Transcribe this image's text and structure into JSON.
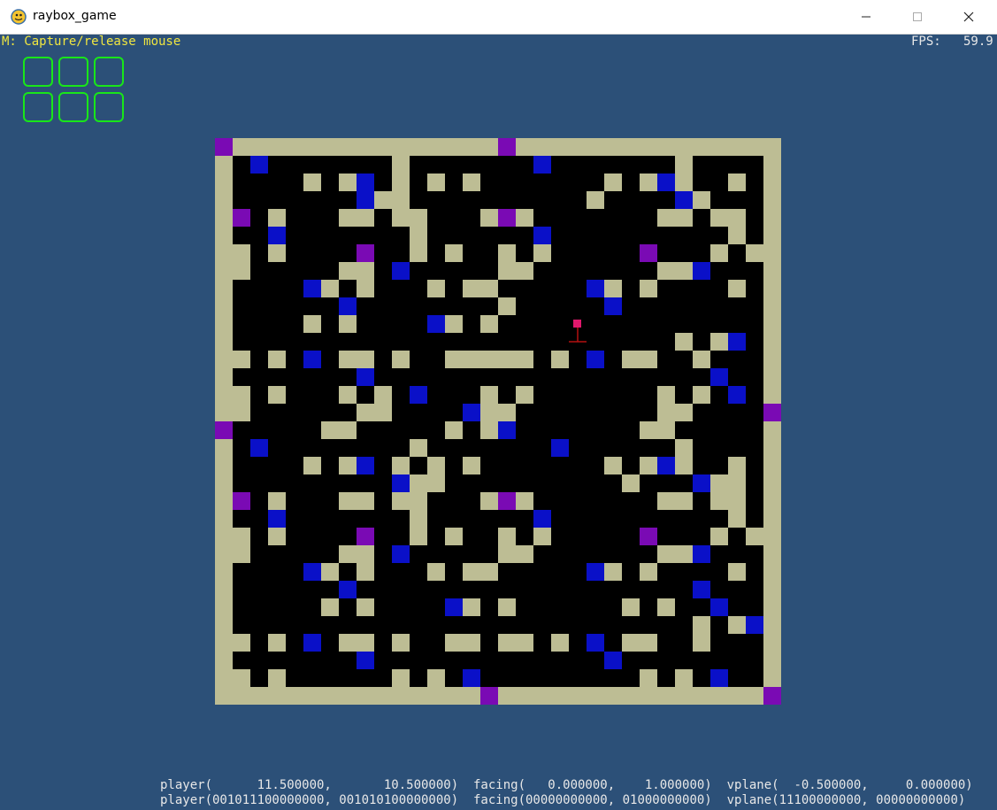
{
  "window": {
    "title": "raybox_game",
    "minimize_label": "Minimize",
    "maximize_label": "Maximize",
    "close_label": "Close"
  },
  "hud": {
    "help_text": "M: Capture/release mouse",
    "fps_text": "FPS:   59.9"
  },
  "inventory": {
    "slots": 6
  },
  "debug": {
    "line1": "player(      11.500000,       10.500000)  facing(   0.000000,    1.000000)  vplane(  -0.500000,     0.000000)",
    "line2": "player(001011100000000, 001010100000000)  facing(00000000000, 01000000000)  vplane(11100000000, 00000000000)"
  },
  "colors": {
    "background": "#2c5078",
    "floor": "#000000",
    "wall": "#bdbd94",
    "blue": "#0a10c8",
    "purple": "#7a0ab4",
    "player": "#e0186c",
    "facing": "#b41010",
    "slot_border": "#19e619"
  },
  "map": {
    "cols": 32,
    "rows": 32,
    "legend": {
      ".": "floor",
      "#": "wall",
      "b": "blue",
      "p": "purple"
    },
    "cells": [
      "p###############p###############",
      "#.b.......#.......b.......#....#",
      "#....#.#b.#.#.#.......#.#b#..#.#",
      "#.......b##..........#....b#...#",
      "#p.#...##.##...#p#.......##.##.#",
      "#..b.......#......b..........#.#",
      "##.#....p..#.#..#.#.....p...#.##",
      "##.....##.b.....##.......##b...#",
      "#....b#.#...#.##.....b#.#....#.#",
      "#......b........#.....b........#",
      "#....#.#....b#.#...............#",
      "#.........................#.#b.#",
      "##.#.b.##.#..#####.#.b.##..#...#",
      "#.......b...................b..#",
      "##.#...#.#.b...#.#.......#.#.b.#",
      "##......##....b##........##....p",
      "p.....##.....#.#b.......##.....#",
      "#.b........#.......b......#....#",
      "#....#.#b.#.#.#.......#.#b#..#.#",
      "#.........b##..........#...b##.#",
      "#p.#...##.##...#p#.......##.##.#",
      "#..b.......#......b..........#.#",
      "##.#....p..#.#..#.#.....p...#.##",
      "##.....##.b.....##.......##b...#",
      "#....b#.#...#.##.....b#.#....#.#",
      "#......b...................b...#",
      "#.....#.#....b#.#......#.#..b..#",
      "#..........................#.#b#",
      "##.#.b.##.#..##.##.#.b.##..#...#",
      "#.......b.............b........#",
      "##.#......#.#.b.........#.#.b..#",
      "###############p###############p"
    ]
  },
  "player": {
    "x": 20.5,
    "y": 10.5,
    "facing": [
      0,
      1
    ]
  }
}
